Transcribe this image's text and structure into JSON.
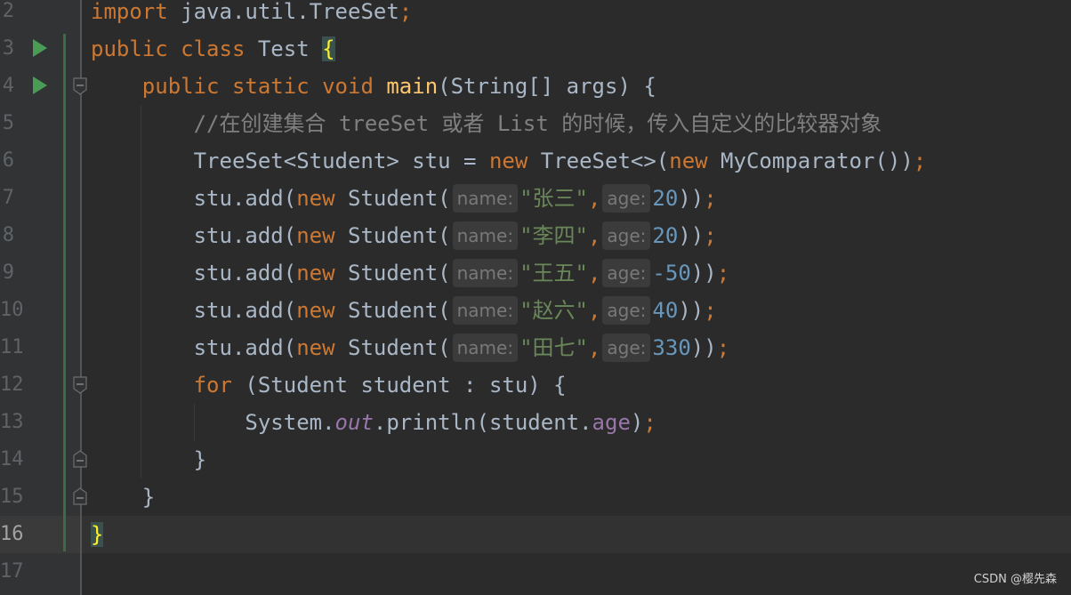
{
  "gutter": {
    "line_numbers": [
      "2",
      "3",
      "4",
      "5",
      "6",
      "7",
      "8",
      "9",
      "10",
      "11",
      "12",
      "13",
      "14",
      "15",
      "16",
      "17"
    ]
  },
  "code": {
    "import_kw": "import",
    "import_path": "java.util.TreeSet",
    "semicolon": ";",
    "public_kw": "public",
    "class_kw": "class",
    "class_name": "Test",
    "open_brace": "{",
    "static_kw": "static",
    "void_kw": "void",
    "main_name": "main",
    "main_params": "(String[] args) {",
    "comment": "//在创建集合 treeSet 或者 List 的时候，传入自定义的比较器对象",
    "treeset_decl": "TreeSet<Student> stu = ",
    "new_kw": "new",
    "treeset_ctor": " TreeSet<>(",
    "comparator_ctor": " MyComparator())",
    "add_prefix": "stu.add(",
    "student_ctor": " Student(",
    "hint_name": "name:",
    "hint_age": "age:",
    "comma": ",",
    "close_add": "))",
    "students": [
      {
        "name": "\"张三\"",
        "age": "20"
      },
      {
        "name": "\"李四\"",
        "age": "20"
      },
      {
        "name": "\"王五\"",
        "age": "-50"
      },
      {
        "name": "\"赵六\"",
        "age": "40"
      },
      {
        "name": "\"田七\"",
        "age": "330"
      }
    ],
    "for_kw": "for",
    "for_body": " (Student student : stu) {",
    "system": "System.",
    "out": "out",
    "println": ".println(student.",
    "age_field": "age",
    "close_paren": ")",
    "close_brace": "}"
  },
  "watermark": "CSDN @樱先森",
  "colors": {
    "background": "#2b2b2b",
    "keyword": "#cc7832",
    "string": "#6a8759",
    "number": "#6897bb",
    "comment": "#808080",
    "method": "#ffc66d",
    "field": "#9876aa",
    "run_icon": "#499c54"
  }
}
